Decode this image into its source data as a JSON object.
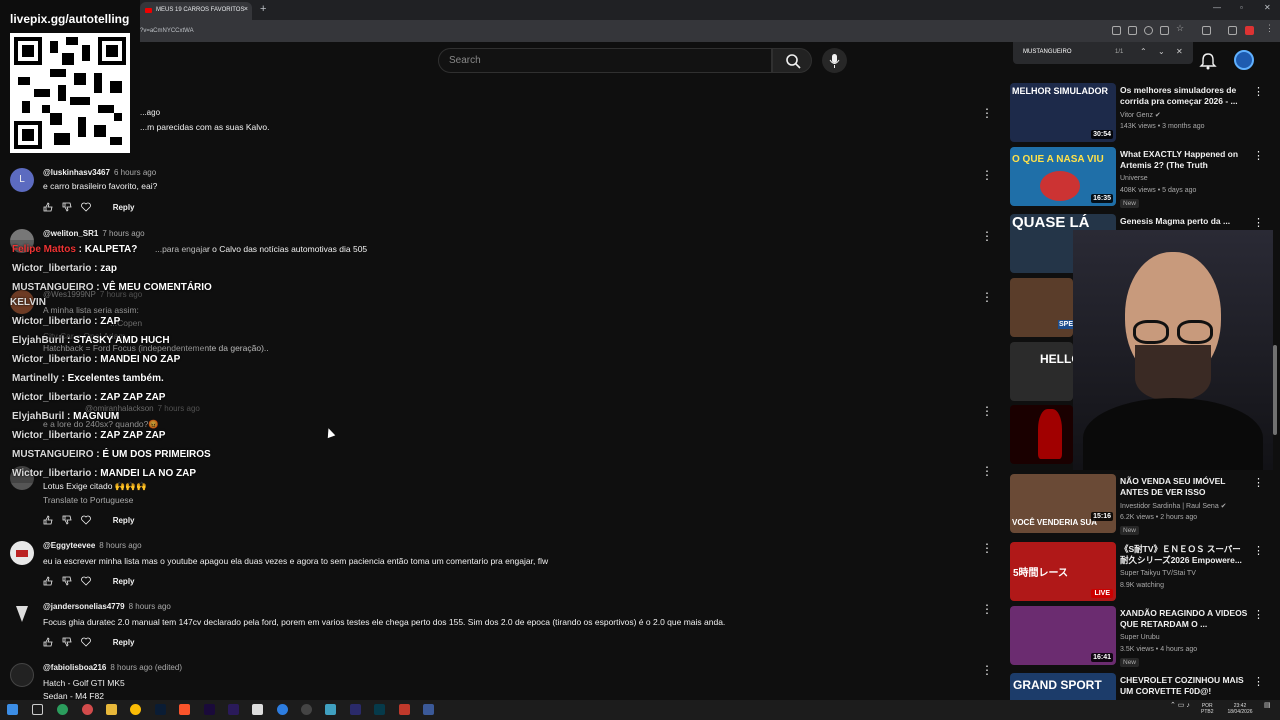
{
  "browser": {
    "tab_title": "MEUS 19 CARROS FAVORITOS",
    "url_fragment": "?v=aCmNYCCxtWA",
    "new_tab": "+",
    "close": "×"
  },
  "find_bar": {
    "query": "MUSTANGUEIRO",
    "count": "1/1"
  },
  "search": {
    "placeholder": "Search"
  },
  "overlay": {
    "qr_title": "livepix.gg/autotelling"
  },
  "comments": [
    {
      "user": "",
      "time": "...ago",
      "text": "...m parecidas com as suas Kalvo.",
      "avatar_color": "#555555"
    },
    {
      "user": "@luskinhasv3467",
      "time": "6 hours ago",
      "text": "e carro brasileiro favorito, eai?",
      "avatar_color": "#5c6bc0",
      "avatar_letter": "L",
      "reply": "Reply"
    },
    {
      "user": "@weliton_SR1",
      "time": "7 hours ago",
      "text": "...para engajar o Calvo das notícias automotivas dia 505",
      "avatar_color": "#777777"
    },
    {
      "user": "@Wes1999NP",
      "time": "7 hours ago",
      "text": "A minha lista seria assim:",
      "text2": "...Copen",
      "text3": "City Car = Opel Adam",
      "text4": "Hatchback = Ford Focus (independentemente da geração)..",
      "avatar_color": "#8d4a2b"
    },
    {
      "user": "@omiranhalackson",
      "time": "7 hours ago",
      "text": "e a lore do 240sx? quando?😡"
    },
    {
      "user": "",
      "time": "",
      "text": "Lotus Exige citado 🙌🙌🙌",
      "translate": "Translate to Portuguese",
      "reply": "Reply"
    },
    {
      "user": "@Eggyteevee",
      "time": "8 hours ago",
      "text": "eu ia escrever minha lista mas o youtube apagou ela duas vezes e agora to sem paciencia então toma um comentario pra engajar, flw",
      "avatar_color": "#d8d8d8",
      "reply": "Reply"
    },
    {
      "user": "@jandersonelias4779",
      "time": "8 hours ago",
      "text": "Focus ghia duratec 2.0 manual tem 147cv declarado pela ford, porem em varios testes ele chega perto dos 155. Sim dos 2.0 de epoca (tirando os esportivos) é o 2.0 que mais anda.",
      "reply": "Reply"
    },
    {
      "user": "@fabiolisboa216",
      "time": "8 hours ago (edited)",
      "text": "Hatch - Golf GTI MK5",
      "text2": "Sedan - M4 F82"
    }
  ],
  "chat": [
    {
      "name": "Felipe Mattos",
      "msg": "KALPETA?"
    },
    {
      "name": "Wictor_libertario",
      "msg": "zap"
    },
    {
      "name": "MUSTANGUEIRO",
      "msg": "VÊ MEU COMENTÁRIO"
    },
    {
      "name": "KELVIN",
      "msg": ""
    },
    {
      "name": "Wictor_libertario",
      "msg": "ZAP"
    },
    {
      "name": "ElyjahBuril",
      "msg": "STASKY AMD HUCH"
    },
    {
      "name": "Wictor_libertario",
      "msg": "MANDEI NO ZAP"
    },
    {
      "name": "Martinelly",
      "msg": "Excelentes também."
    },
    {
      "name": "Wictor_libertario",
      "msg": "ZAP ZAP ZAP"
    },
    {
      "name": "ElyjahBuril",
      "msg": "MAGNUM"
    },
    {
      "name": "Wictor_libertario",
      "msg": "ZAP ZAP ZAP"
    },
    {
      "name": "MUSTANGUEIRO",
      "msg": "É UM DOS PRIMEIROS"
    },
    {
      "name": "Wictor_libertario",
      "msg": "MANDEI LA NO ZAP"
    }
  ],
  "recommendations": [
    {
      "title": "Os melhores simuladores de corrida pra começar 2026 - ...",
      "channel": "Vitor Genz ✔",
      "meta": "143K views • 3 months ago",
      "duration": "30:54",
      "thumb_text": "MELHOR SIMULADOR",
      "thumb_color": "#1d2a4a"
    },
    {
      "title": "What EXACTLY Happened on Artemis 2? (The Truth Revealed)",
      "channel": "Universe",
      "meta": "408K views • 5 days ago",
      "badge": "New",
      "duration": "16:35",
      "thumb_text": "O QUE A NASA VIU",
      "thumb_color": "#1f6fa8"
    },
    {
      "title": "Genesis Magma perto da ...",
      "channel": "",
      "meta": "",
      "thumb_text": "QUASE LÁ",
      "thumb_color": "#243548"
    },
    {
      "title": "",
      "channel": "",
      "meta": "",
      "thumb_text": "SPE",
      "thumb_color": "#5a3d2a"
    },
    {
      "title": "",
      "channel": "",
      "meta": "",
      "thumb_text": "HELLO",
      "thumb_color": "#2b2b2b"
    },
    {
      "title": "",
      "channel": "",
      "meta": "",
      "thumb_text": "",
      "thumb_color": "#6b0000"
    },
    {
      "title": "NÃO VENDA SEU IMÓVEL ANTES DE VER ISSO",
      "channel": "Investidor Sardinha | Raul Sena ✔",
      "meta": "6.2K views • 2 hours ago",
      "badge": "New",
      "duration": "15:16",
      "thumb_text": "VOCÊ VENDERIA SUA",
      "thumb_color": "#6a4a36"
    },
    {
      "title": "《S耐TV》ＥＮＥＯＳ スーパー耐久シリーズ2026 Empowere...",
      "channel": "Super Taikyu TV/Stai TV",
      "meta": "8.9K watching",
      "live": "LIVE",
      "thumb_text": "5時間レース",
      "thumb_color": "#b01818"
    },
    {
      "title": "XANDÃO REAGINDO A VIDEOS QUE RETARDAM O ...",
      "channel": "Super Urubu",
      "meta": "3.5K views • 4 hours ago",
      "badge": "New",
      "duration": "16:41",
      "thumb_text": "",
      "thumb_color": "#6b2c70"
    },
    {
      "title": "CHEVROLET COZINHOU MAIS UM CORVETTE F0D@!",
      "channel": "",
      "meta": "",
      "thumb_text": "GRAND SPORT",
      "thumb_color": "#1c3c6a"
    }
  ],
  "taskbar": {
    "lang": "POR\nPTB2",
    "time": "23:42",
    "date": "18/04/2026"
  },
  "colors": {
    "accent": "#3ea6ff",
    "bg": "#0f0f0f",
    "live": "#cc0000"
  }
}
